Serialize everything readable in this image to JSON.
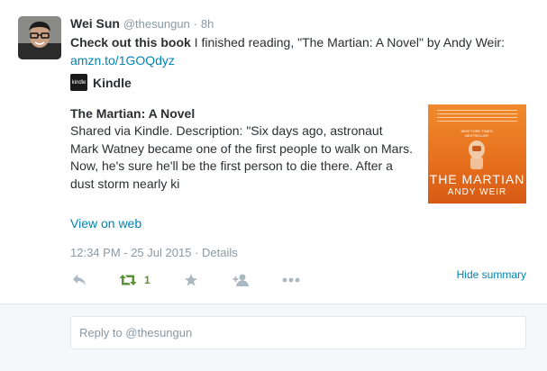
{
  "tweet": {
    "fullname": "Wei Sun",
    "handle": "@thesungun",
    "dot": "·",
    "time": "8h",
    "text_bold": "Check out this book",
    "text_rest": " I finished reading, \"The Martian: A Novel\" by Andy Weir:",
    "link": "amzn.to/1GOQdyz"
  },
  "card": {
    "source_logo_text": "kindle",
    "source_name": "Kindle",
    "title": "The Martian: A Novel",
    "description": "Shared via Kindle. Description: \"Six days ago, astronaut Mark Watney became one of the first people to walk on Mars. Now, he's sure he'll be the first person to die there. After a dust storm nearly ki",
    "cover": {
      "badge": "NEW YORK TIMES BESTSELLER",
      "title": "THE MARTIAN",
      "author": "ANDY WEIR"
    },
    "view_on_web": "View on web"
  },
  "meta": {
    "timestamp": "12:34 PM - 25 Jul 2015",
    "separator": " · ",
    "details": "Details"
  },
  "actions": {
    "retweet_count": "1",
    "hide_summary": "Hide summary"
  },
  "reply": {
    "placeholder": "Reply to @thesungun"
  },
  "colors": {
    "link": "#0084b4",
    "muted": "#8899a6",
    "retweet_green": "#5c913b",
    "book_orange": "#e66f1d"
  },
  "icons": [
    "reply-icon",
    "retweet-icon",
    "favorite-icon",
    "follow-icon",
    "more-icon"
  ]
}
